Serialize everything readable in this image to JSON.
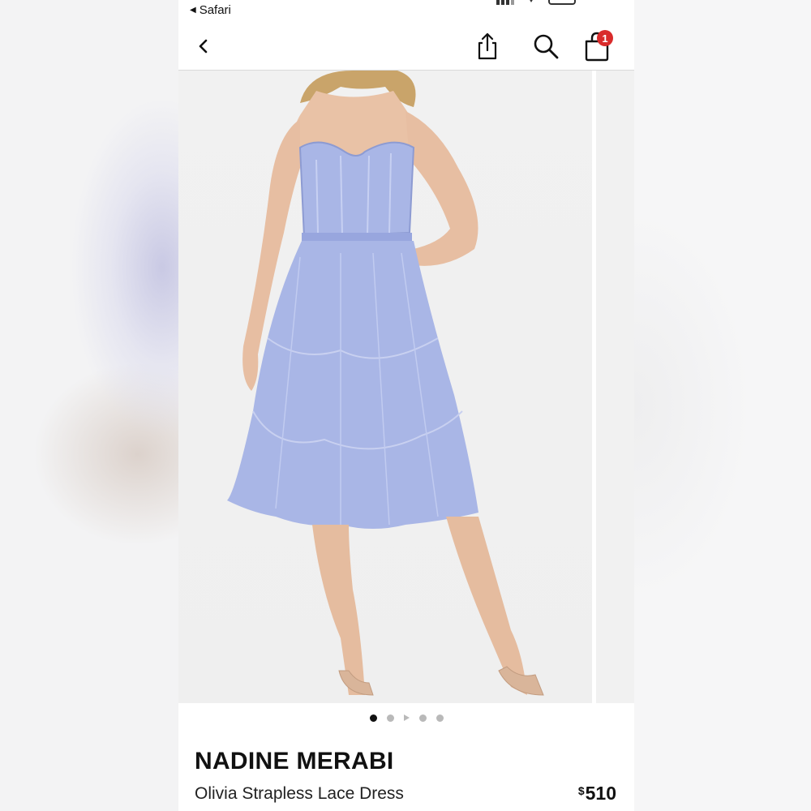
{
  "status_bar": {
    "back_app_label": "Safari"
  },
  "nav": {
    "cart_count": "1"
  },
  "gallery": {
    "image_description_icon": "product-photo",
    "dot_count": 5,
    "active_index": 0
  },
  "product": {
    "brand": "NADINE MERABI",
    "name": "Olivia Strapless Lace Dress",
    "price_currency": "$",
    "price_value": "510"
  },
  "colors": {
    "dress": "#a9b6e6",
    "skin": "#e8c1a8",
    "badge": "#d92b2b"
  }
}
